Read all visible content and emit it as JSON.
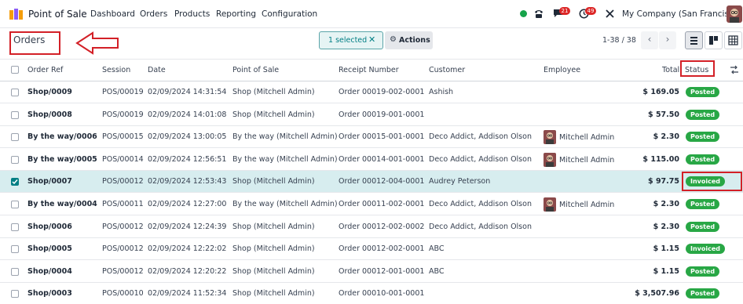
{
  "navbar": {
    "app_name": "Point of Sale",
    "menu": [
      "Dashboard",
      "Orders",
      "Products",
      "Reporting",
      "Configuration"
    ],
    "messages_count": "21",
    "activities_count": "49",
    "company": "My Company (San Francisco)"
  },
  "control_panel": {
    "title": "Orders",
    "selected_label": "1 selected",
    "actions_label": "Actions",
    "pager": "1-38 / 38"
  },
  "table": {
    "columns": [
      "Order Ref",
      "Session",
      "Date",
      "Point of Sale",
      "Receipt Number",
      "Customer",
      "Employee",
      "Total",
      "Status"
    ],
    "rows": [
      {
        "ref": "Shop/0009",
        "session": "POS/00019",
        "date": "02/09/2024 14:31:54",
        "pos": "Shop (Mitchell Admin)",
        "receipt": "Order 00019-002-0001",
        "customer": "Ashish",
        "employee": "",
        "total": "$ 169.05",
        "status": "Posted"
      },
      {
        "ref": "Shop/0008",
        "session": "POS/00019",
        "date": "02/09/2024 14:01:08",
        "pos": "Shop (Mitchell Admin)",
        "receipt": "Order 00019-001-0001",
        "customer": "",
        "employee": "",
        "total": "$ 57.50",
        "status": "Posted"
      },
      {
        "ref": "By the way/0006",
        "session": "POS/00015",
        "date": "02/09/2024 13:00:05",
        "pos": "By the way (Mitchell Admin)",
        "receipt": "Order 00015-001-0001",
        "customer": "Deco Addict, Addison Olson",
        "employee": "Mitchell Admin",
        "total": "$ 2.30",
        "status": "Posted"
      },
      {
        "ref": "By the way/0005",
        "session": "POS/00014",
        "date": "02/09/2024 12:56:51",
        "pos": "By the way (Mitchell Admin)",
        "receipt": "Order 00014-001-0001",
        "customer": "Deco Addict, Addison Olson",
        "employee": "Mitchell Admin",
        "total": "$ 115.00",
        "status": "Posted"
      },
      {
        "ref": "Shop/0007",
        "session": "POS/00012",
        "date": "02/09/2024 12:53:43",
        "pos": "Shop (Mitchell Admin)",
        "receipt": "Order 00012-004-0001",
        "customer": "Audrey Peterson",
        "employee": "",
        "total": "$ 97.75",
        "status": "Invoiced"
      },
      {
        "ref": "By the way/0004",
        "session": "POS/00011",
        "date": "02/09/2024 12:27:00",
        "pos": "By the way (Mitchell Admin)",
        "receipt": "Order 00011-002-0001",
        "customer": "Deco Addict, Addison Olson",
        "employee": "Mitchell Admin",
        "total": "$ 2.30",
        "status": "Posted"
      },
      {
        "ref": "Shop/0006",
        "session": "POS/00012",
        "date": "02/09/2024 12:24:39",
        "pos": "Shop (Mitchell Admin)",
        "receipt": "Order 00012-002-0002",
        "customer": "Deco Addict, Addison Olson",
        "employee": "",
        "total": "$ 2.30",
        "status": "Posted"
      },
      {
        "ref": "Shop/0005",
        "session": "POS/00012",
        "date": "02/09/2024 12:22:02",
        "pos": "Shop (Mitchell Admin)",
        "receipt": "Order 00012-002-0001",
        "customer": "ABC",
        "employee": "",
        "total": "$ 1.15",
        "status": "Invoiced"
      },
      {
        "ref": "Shop/0004",
        "session": "POS/00012",
        "date": "02/09/2024 12:20:22",
        "pos": "Shop (Mitchell Admin)",
        "receipt": "Order 00012-001-0001",
        "customer": "ABC",
        "employee": "",
        "total": "$ 1.15",
        "status": "Posted"
      },
      {
        "ref": "Shop/0003",
        "session": "POS/00010",
        "date": "02/09/2024 11:52:34",
        "pos": "Shop (Mitchell Admin)",
        "receipt": "Order 00010-001-0001",
        "customer": "",
        "employee": "",
        "total": "$ 3,507.96",
        "status": "Posted"
      }
    ],
    "selected_row": 4
  },
  "colors": {
    "brand": "#017e84",
    "posted": "#28a745",
    "invoiced": "#28a745",
    "annotation": "#d32027",
    "selected_row": "#d7edef"
  },
  "icons": [
    "app-icon",
    "phone-icon",
    "chat-icon",
    "clock-icon",
    "tools-icon",
    "close-icon",
    "gear-icon",
    "chevron-left-icon",
    "chevron-right-icon",
    "list-view-icon",
    "kanban-view-icon",
    "pivot-view-icon",
    "column-settings-icon",
    "checkmark-icon",
    "avatar"
  ]
}
